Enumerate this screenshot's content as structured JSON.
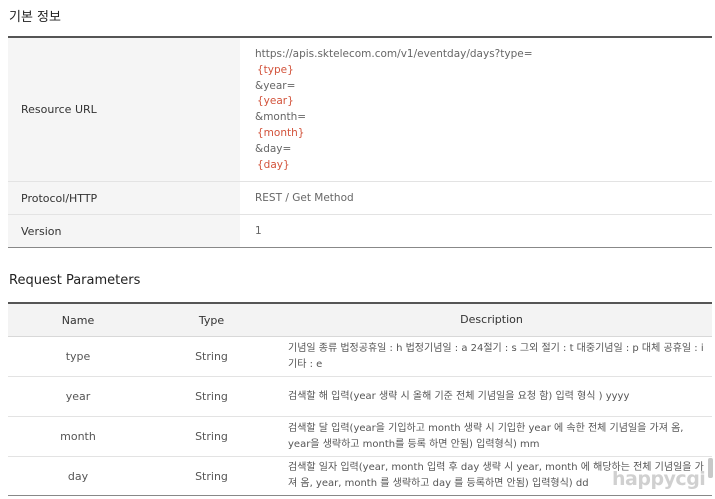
{
  "basic_info": {
    "title": "기본 정보",
    "resource_url_label": "Resource URL",
    "resource_url_lines": [
      {
        "text": "https://apis.sktelecom.com/v1/eventday/days?type=",
        "param": false
      },
      {
        "text": "{type}",
        "param": true
      },
      {
        "text": "&year=",
        "param": false
      },
      {
        "text": "{year}",
        "param": true
      },
      {
        "text": "&month=",
        "param": false
      },
      {
        "text": "{month}",
        "param": true
      },
      {
        "text": "&day=",
        "param": false
      },
      {
        "text": "{day}",
        "param": true
      }
    ],
    "protocol_label": "Protocol/HTTP",
    "protocol_value": "REST / Get Method",
    "version_label": "Version",
    "version_value": "1"
  },
  "request_parameters": {
    "title": "Request Parameters",
    "headers": {
      "name": "Name",
      "type": "Type",
      "description": "Description"
    },
    "rows": [
      {
        "name": "type",
        "type": "String",
        "description": "기념일 종류 법정공휴일 : h 법정기념일 : a 24절기 : s 그외 절기 : t 대중기념일 : p 대체 공휴일 : i 기타 : e"
      },
      {
        "name": "year",
        "type": "String",
        "description": "검색할 해 입력(year 생략 시 올해 기준 전체 기념일을 요청 함) 입력 형식 ) yyyy"
      },
      {
        "name": "month",
        "type": "String",
        "description": "검색할 달 입력(year을 기입하고 month 생략 시 기입한 year 에 속한 전체 기념일을 가져 옴, year을 생략하고 month를 등록 하면 안됨) 입력형식) mm"
      },
      {
        "name": "day",
        "type": "String",
        "description": "검색할 일자 입력(year, month 입력 후 day 생략 시 year, month 에 해당하는 전체 기념일을 가져 옴, year, month 를 생략하고 day 를 등록하면 안됨) 입력형식) dd"
      }
    ]
  },
  "watermark": "happycgi",
  "colors": {
    "param": "#d2523a",
    "header_bg": "#f5f5f5",
    "border_dark": "#555555"
  }
}
